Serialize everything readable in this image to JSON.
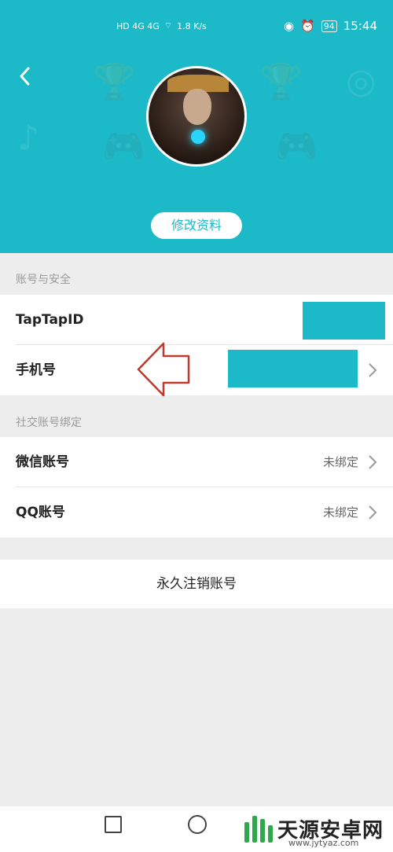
{
  "status_bar": {
    "network": "HD 4G 4G",
    "speed": "1.8 K/s",
    "battery": "94",
    "time": "15:44"
  },
  "header": {
    "edit_profile_label": "修改资料",
    "accent_color": "#1cb9c8"
  },
  "sections": {
    "account_security_title": "账号与安全",
    "taptap_id_label": "TapTapID",
    "phone_label": "手机号",
    "social_binding_title": "社交账号绑定",
    "wechat_label": "微信账号",
    "wechat_status": "未绑定",
    "qq_label": "QQ账号",
    "qq_status": "未绑定"
  },
  "delete_account_label": "永久注销账号",
  "watermark": {
    "title": "天源安卓网",
    "url": "www.jytyaz.com"
  }
}
